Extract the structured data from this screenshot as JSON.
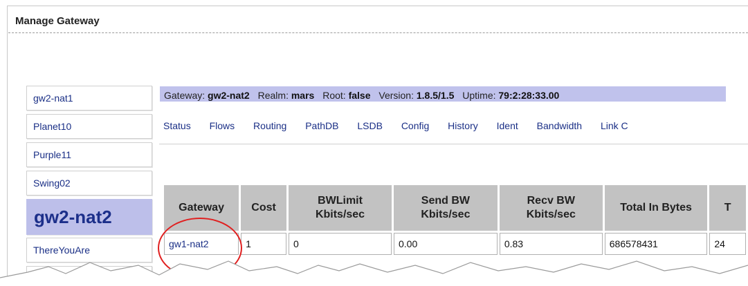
{
  "window": {
    "title": "Manage Gateway"
  },
  "sidebar": {
    "items": [
      {
        "label": "gw2-nat1"
      },
      {
        "label": "Planet10"
      },
      {
        "label": "Purple11"
      },
      {
        "label": "Swing02"
      },
      {
        "label": "gw2-nat2",
        "active": true
      },
      {
        "label": "ThereYouAre"
      }
    ]
  },
  "infobar": {
    "gateway_label": "Gateway:",
    "gateway_value": "gw2-nat2",
    "realm_label": "Realm:",
    "realm_value": "mars",
    "root_label": "Root:",
    "root_value": "false",
    "version_label": "Version:",
    "version_value": "1.8.5/1.5",
    "uptime_label": "Uptime:",
    "uptime_value": "79:2:28:33.00"
  },
  "nav": {
    "tabs": [
      "Status",
      "Flows",
      "Routing",
      "PathDB",
      "LSDB",
      "Config",
      "History",
      "Ident",
      "Bandwidth",
      "Link C"
    ]
  },
  "table": {
    "headers": [
      "Gateway",
      "Cost",
      "BWLimit Kbits/sec",
      "Send BW Kbits/sec",
      "Recv BW Kbits/sec",
      "Total In Bytes",
      "T"
    ],
    "rows": [
      [
        "gw1-nat2",
        "1",
        "0",
        "0.00",
        "0.83",
        "686578431",
        "24"
      ]
    ]
  },
  "colors": {
    "accent": "#bdbfea",
    "link": "#1a2f86",
    "header_bg": "#c2c2c2",
    "annotation": "#e02020"
  }
}
